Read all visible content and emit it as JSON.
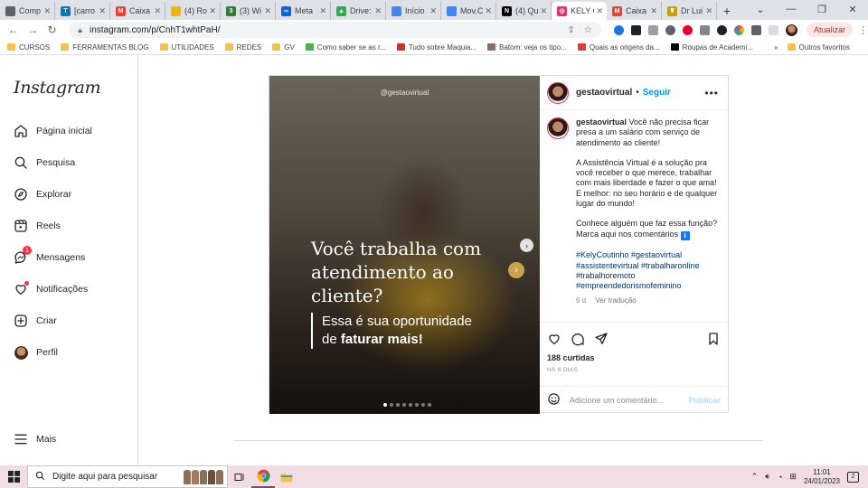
{
  "browser": {
    "tabs": [
      {
        "label": "Comp",
        "color": "#5f6368",
        "glyph": ""
      },
      {
        "label": "[carro",
        "color": "#0079bf",
        "glyph": "T"
      },
      {
        "label": "Caixa",
        "color": "#ea4335",
        "glyph": "M"
      },
      {
        "label": "(4) Ro",
        "color": "#f4b400",
        "glyph": ""
      },
      {
        "label": "(3) Wi",
        "color": "#2e7d32",
        "glyph": "3"
      },
      {
        "label": "Meta",
        "color": "#0668e1",
        "glyph": "∞"
      },
      {
        "label": "Drive:",
        "color": "#34a853",
        "glyph": "▲"
      },
      {
        "label": "Início",
        "color": "#4285f4",
        "glyph": ""
      },
      {
        "label": "Mov.C",
        "color": "#4285f4",
        "glyph": ""
      },
      {
        "label": "(4) Qu",
        "color": "#000000",
        "glyph": "N"
      },
      {
        "label": "KELY C",
        "color": "#e1306c",
        "glyph": "◎",
        "active": true
      },
      {
        "label": "Caixa",
        "color": "#ea4335",
        "glyph": "M"
      },
      {
        "label": "Dr Lui",
        "color": "#c7a008",
        "glyph": "☤"
      }
    ],
    "new_tab": "+",
    "url": "instagram.com/p/CnhT1whtPaH/",
    "update_label": "Atualizar",
    "bookmarks": [
      {
        "label": "CURSOS",
        "type": "folder"
      },
      {
        "label": "FERRAMENTAS BLOG",
        "type": "folder"
      },
      {
        "label": "UTILIDADES",
        "type": "folder"
      },
      {
        "label": "REDES",
        "type": "folder"
      },
      {
        "label": "GV",
        "type": "folder"
      },
      {
        "label": "Como saber se as r...",
        "type": "link",
        "color": "#4caf50"
      },
      {
        "label": "Tudo sobre Maquia...",
        "type": "link",
        "color": "#d32f2f"
      },
      {
        "label": "Batom: veja os tipo...",
        "type": "link",
        "color": "#8d6e63"
      },
      {
        "label": "Quais as origens da...",
        "type": "link",
        "color": "#e53935"
      },
      {
        "label": "Roupas de Academi...",
        "type": "link",
        "color": "#000000"
      }
    ],
    "bookmarks_more": "»",
    "other_favorites": "Outros favoritos"
  },
  "instagram": {
    "logo": "Instagram",
    "nav": [
      {
        "key": "home",
        "label": "Página inicial"
      },
      {
        "key": "search",
        "label": "Pesquisa"
      },
      {
        "key": "explore",
        "label": "Explorar"
      },
      {
        "key": "reels",
        "label": "Reels"
      },
      {
        "key": "messages",
        "label": "Mensagens",
        "badge": "1"
      },
      {
        "key": "notifications",
        "label": "Notificações"
      },
      {
        "key": "create",
        "label": "Criar"
      },
      {
        "key": "profile",
        "label": "Perfil"
      }
    ],
    "more_label": "Mais"
  },
  "post": {
    "media": {
      "handle": "@gestaovirtual",
      "headline": "Você trabalha com atendimento ao cliente?",
      "sub_line1": "Essa é sua oportunidade",
      "sub_line2_prefix": "de ",
      "sub_line2_bold": "faturar mais!",
      "slide_count": 8,
      "current_slide": 0
    },
    "username": "gestaovirtual",
    "separator": "•",
    "follow_label": "Seguir",
    "caption": {
      "p1": "Você não precisa ficar presa a um salário com serviço de atendimento ao cliente!",
      "p2": "A Assistência Virtual é a solução pra você receber o que merece, trabalhar com mais liberdade e fazer o que ama! E melhor: no seu horário e de qualquer lugar do mundo!",
      "p3": "Conhece alguém que faz essa função? Marca aqui nos comentários",
      "p3_emoji": "ℹ",
      "hashtags": [
        "#KelyCoutinho #gestaovirtual",
        "#assistentevirtual #trabalharonline",
        "#trabalhoremoto",
        "#empreendedorismofeminino"
      ]
    },
    "caption_age": "6 d",
    "translate_label": "Ver tradução",
    "likes": "188 curtidas",
    "posted_ago": "HÁ 6 DIAS",
    "comment_placeholder": "Adicione um comentário...",
    "publish_label": "Publicar"
  },
  "taskbar": {
    "search_placeholder": "Digite aqui para pesquisar",
    "time": "11:01",
    "date": "24/01/2023",
    "notifications": "2"
  }
}
